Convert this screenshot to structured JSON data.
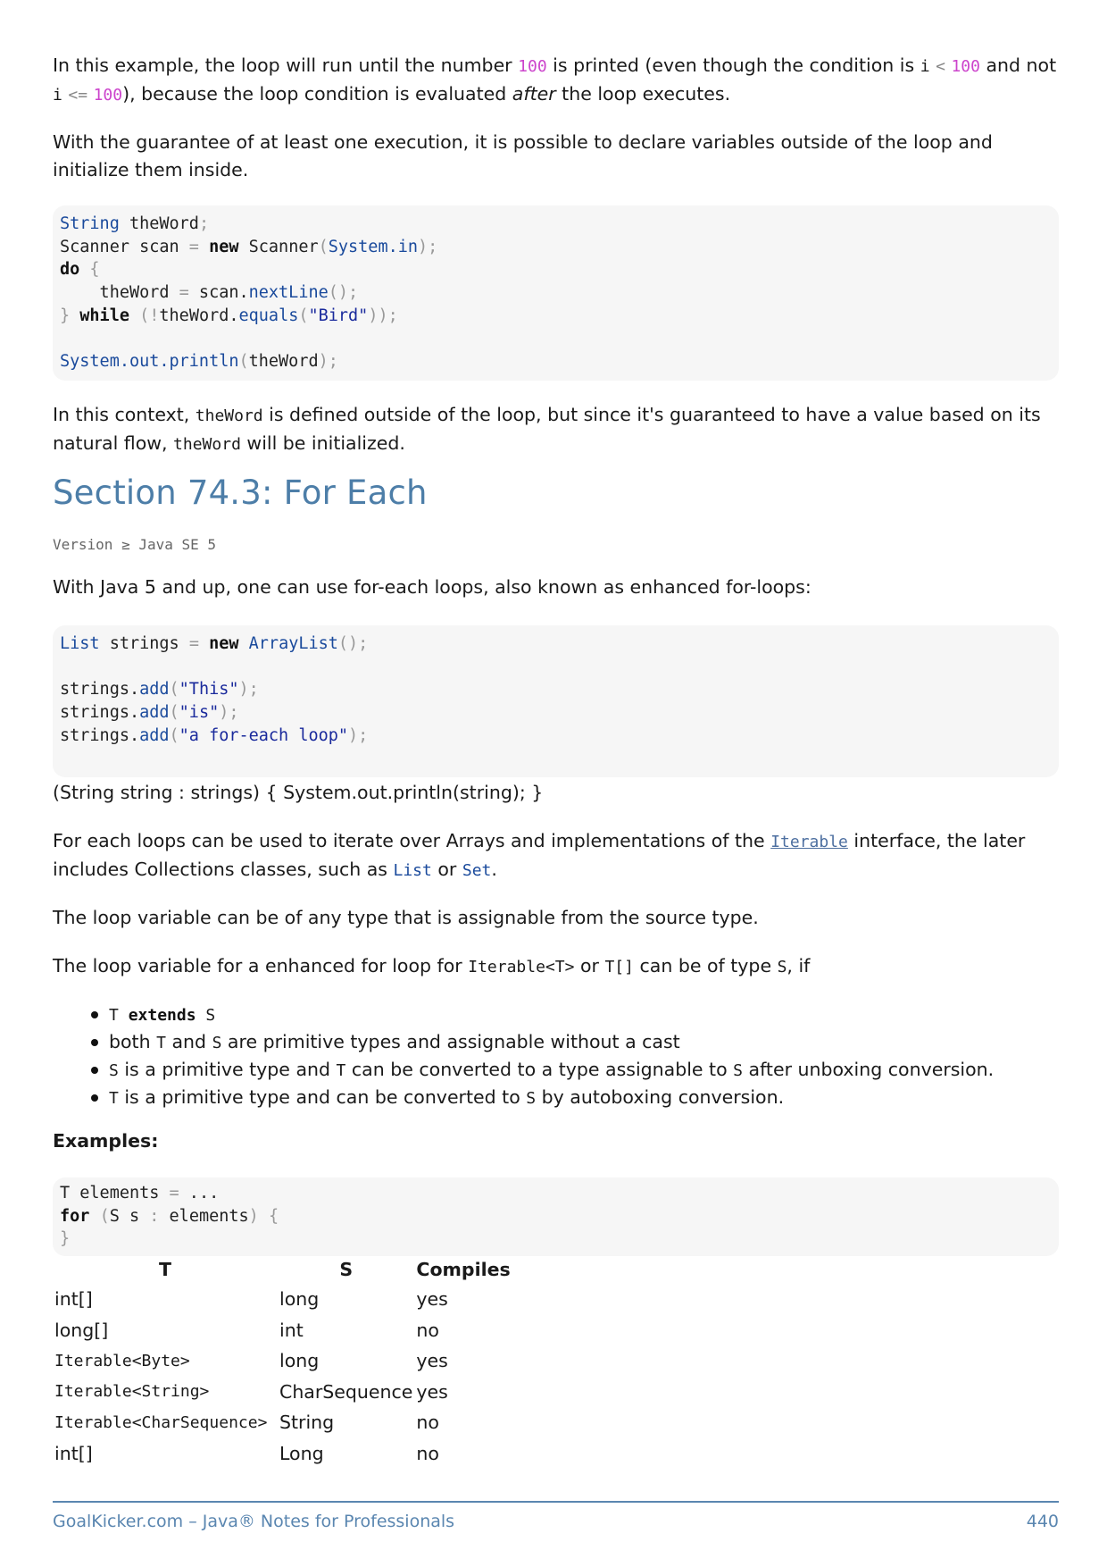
{
  "para1": {
    "t1": "In this example, the loop will run until the number ",
    "n1": "100",
    "t2": " is printed (even though the condition is ",
    "c1": "i",
    "c2": "<",
    "n2": "100",
    "t3": " and not ",
    "c3": "i",
    "c4": "<=",
    "n3": "100",
    "t4": "), because the loop condition is evaluated ",
    "em": "after",
    "t5": " the loop executes."
  },
  "para2": "With the guarantee of at least one execution, it is possible to declare variables outside of the loop and initialize them inside.",
  "code1": {
    "l1_type": "String",
    "l1_rest": " theWord",
    "l2_a": "Scanner scan ",
    "l2_new": "new",
    "l2_b": " Scanner",
    "l2_sys": "System.in",
    "l3_do": "do",
    "l4_a": "    theWord ",
    "l4_b": " scan.",
    "l4_fn": "nextLine",
    "l5_while": "while",
    "l5_a": "theWord.",
    "l5_fn": "equals",
    "l5_str": "\"Bird\"",
    "l7_fn": "System.out.println",
    "l7_arg": "theWord"
  },
  "para3": {
    "t1": "In this context, ",
    "c1": "theWord",
    "t2": " is defined outside of the loop, but since it's guaranteed to have a value based on its natural flow, ",
    "c2": "theWord",
    "t3": " will be initialized."
  },
  "section_title": "Section 74.3: For Each",
  "version": "Version ≥ Java SE 5",
  "para4": "With Java 5 and up, one can use for-each loops, also known as enhanced for-loops:",
  "code2": {
    "l1_type": "List",
    "l1_a": " strings ",
    "l1_new": "new",
    "l1_cls": "ArrayList",
    "l3_a": "strings.",
    "l3_fn": "add",
    "l3_str": "\"This\"",
    "l4_a": "strings.",
    "l4_fn": "add",
    "l4_str": "\"is\"",
    "l5_a": "strings.",
    "l5_fn": "add",
    "l5_str": "\"a for-each loop\""
  },
  "para5": "(String string : strings) { System.out.println(string); }",
  "para6": {
    "t1": "For each loops can be used to iterate over Arrays and implementations of the ",
    "link": "Iterable",
    "t2": " interface, the later includes Collections classes, such as ",
    "c1": "List",
    "t3": " or ",
    "c2": "Set",
    "t4": "."
  },
  "para7": "The loop variable can be of any type that is assignable from the source type.",
  "para8": {
    "t1": "The loop variable for a enhanced for loop for ",
    "c1": "Iterable<T>",
    "t2": " or ",
    "c2": "T[]",
    "t3": " can be of type ",
    "c3": "S",
    "t4": ", if"
  },
  "bullets": {
    "b1_a": "T ",
    "b1_kw": "extends",
    "b1_b": " S",
    "b2_t1": "both ",
    "b2_c1": "T",
    "b2_t2": " and ",
    "b2_c2": "S",
    "b2_t3": " are primitive types and assignable without a cast",
    "b3_c1": "S",
    "b3_t1": " is a primitive type and ",
    "b3_c2": "T",
    "b3_t2": " can be converted to a type assignable to ",
    "b3_c3": "S",
    "b3_t3": " after unboxing conversion.",
    "b4_c1": "T",
    "b4_t1": " is a primitive type and can be converted to ",
    "b4_c2": "S",
    "b4_t2": " by autoboxing conversion."
  },
  "examples_label": "Examples:",
  "code3": {
    "l1": "T elements ",
    "l1_b": " ...",
    "l2_kw": "for",
    "l2_a": "S s ",
    "l2_b": " elements"
  },
  "table": {
    "headers": [
      "T",
      "S",
      "Compiles"
    ],
    "rows": [
      {
        "t": "int[]",
        "s": "long",
        "c": "yes"
      },
      {
        "t": "long[]",
        "s": "int",
        "c": "no"
      },
      {
        "t": "Iterable<Byte>",
        "s": "long",
        "c": "yes"
      },
      {
        "t": "Iterable<String>",
        "s": "CharSequence",
        "c": "yes"
      },
      {
        "t": "Iterable<CharSequence>",
        "s": "String",
        "c": "no"
      },
      {
        "t": "int[]",
        "s": "Long",
        "c": "no"
      }
    ]
  },
  "footer": {
    "left": "GoalKicker.com – Java® Notes for Professionals",
    "page": "440"
  }
}
